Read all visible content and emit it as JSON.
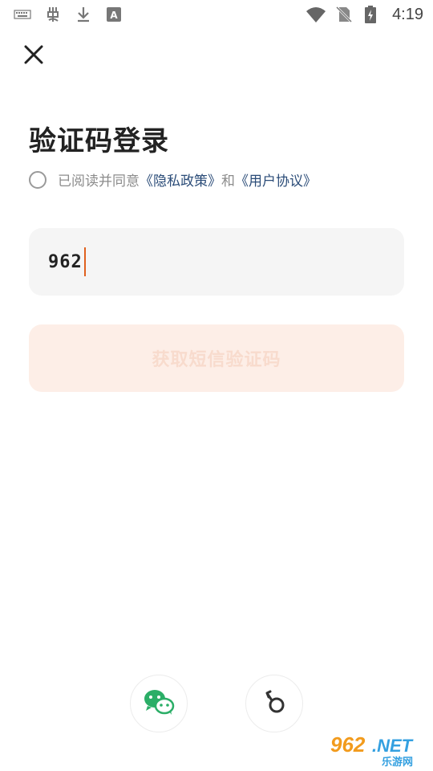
{
  "status_bar": {
    "time": "4:19",
    "left_icons": [
      "keyboard-icon",
      "app-icon",
      "download-icon",
      "font-icon"
    ],
    "right_icons": [
      "wifi-icon",
      "no-sim-icon",
      "battery-charging-icon"
    ]
  },
  "login": {
    "title": "验证码登录",
    "agreement": {
      "prefix": "已阅读并同意",
      "privacy_link": "《隐私政策》",
      "and": "和",
      "user_link": "《用户协议》"
    },
    "phone_input_value": "962",
    "get_code_button": "获取短信验证码"
  },
  "alt_login": {
    "icons": [
      "wechat-icon",
      "key-icon"
    ]
  },
  "watermark": {
    "number": "962",
    "suffix": ".NET",
    "cn": "乐游网"
  },
  "colors": {
    "accent": "#e0601e",
    "button_bg_disabled": "#fdeee7",
    "link": "#2b4c78",
    "wechat_green": "#2bae67"
  }
}
